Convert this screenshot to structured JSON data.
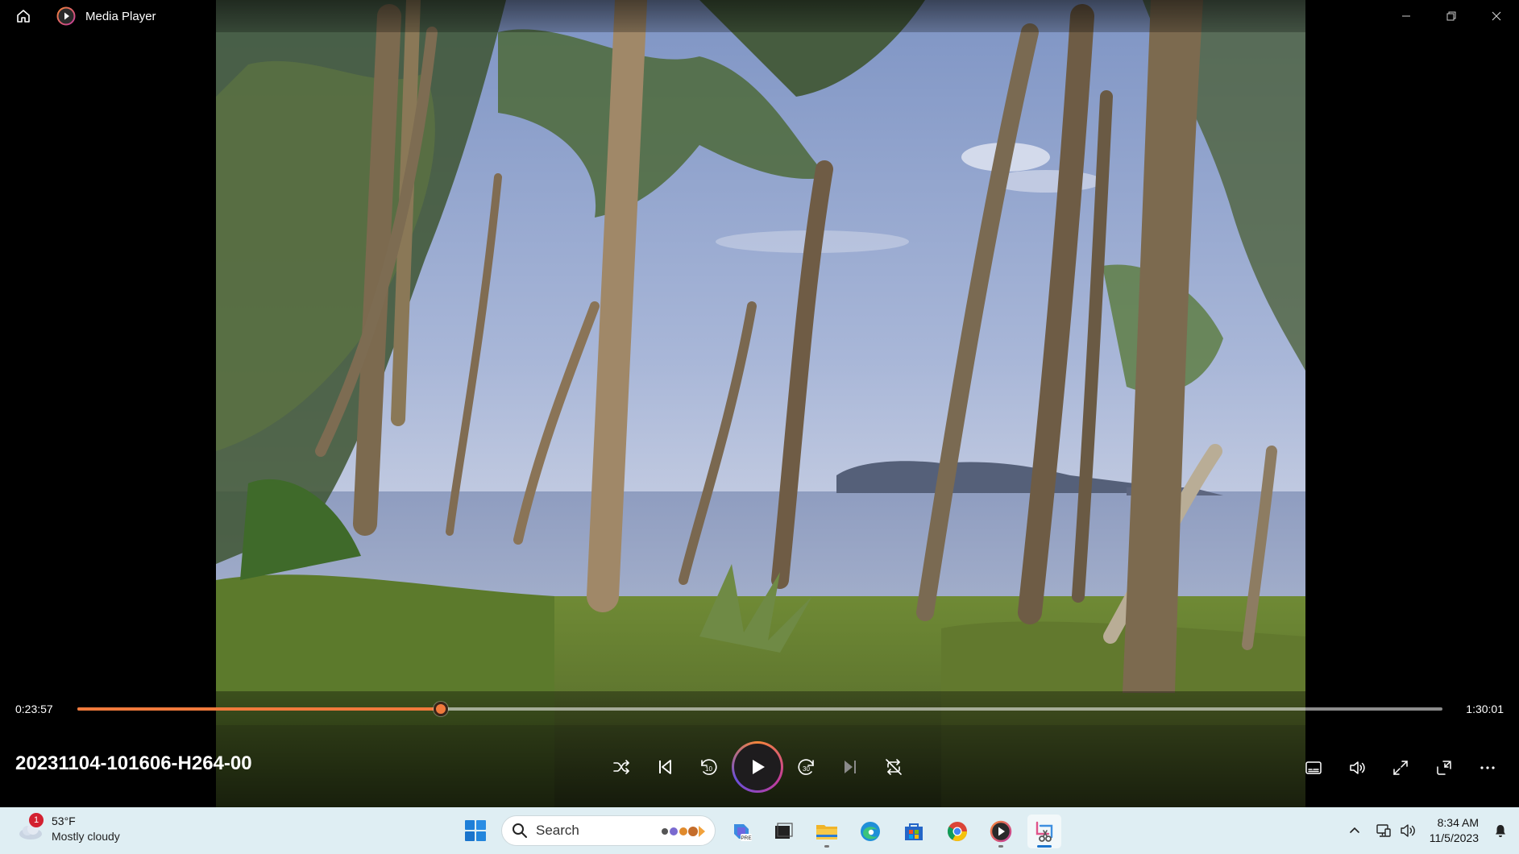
{
  "window": {
    "app_title": "Media Player",
    "icons": {
      "home": "home-icon",
      "logo": "media-player-logo-icon",
      "minimize": "minimize-icon",
      "restore": "restore-icon",
      "close": "close-icon"
    }
  },
  "player": {
    "current_time": "0:23:57",
    "total_time": "1:30:01",
    "progress_fraction": 0.266,
    "media_title": "20231104-101606-H264-00",
    "state": "paused",
    "transport_icons": [
      "shuffle-icon",
      "previous-icon",
      "skip-back-10-icon",
      "play-icon",
      "skip-forward-30-icon",
      "next-icon",
      "repeat-off-icon"
    ],
    "skip_back_label": "10",
    "skip_forward_label": "30",
    "tool_icons": [
      "captions-icon",
      "volume-icon",
      "fullscreen-icon",
      "mini-player-icon",
      "more-options-icon"
    ],
    "accent_color": "#f07a3c"
  },
  "taskbar": {
    "weather": {
      "badge_count": "1",
      "temperature": "53°F",
      "condition": "Mostly cloudy",
      "icon": "cloudy-weather-icon"
    },
    "start_icon": "windows-start-icon",
    "search_placeholder": "Search",
    "pinned_apps": [
      "copilot-icon",
      "task-view-icon",
      "file-explorer-icon",
      "edge-icon",
      "microsoft-store-icon",
      "chrome-icon",
      "media-player-icon",
      "snipping-tool-icon"
    ],
    "tray": {
      "icons": [
        "show-hidden-icons-chevron-icon",
        "network-icon",
        "speaker-icon",
        "notification-bell-icon"
      ],
      "time": "8:34 AM",
      "date": "11/5/2023"
    }
  }
}
